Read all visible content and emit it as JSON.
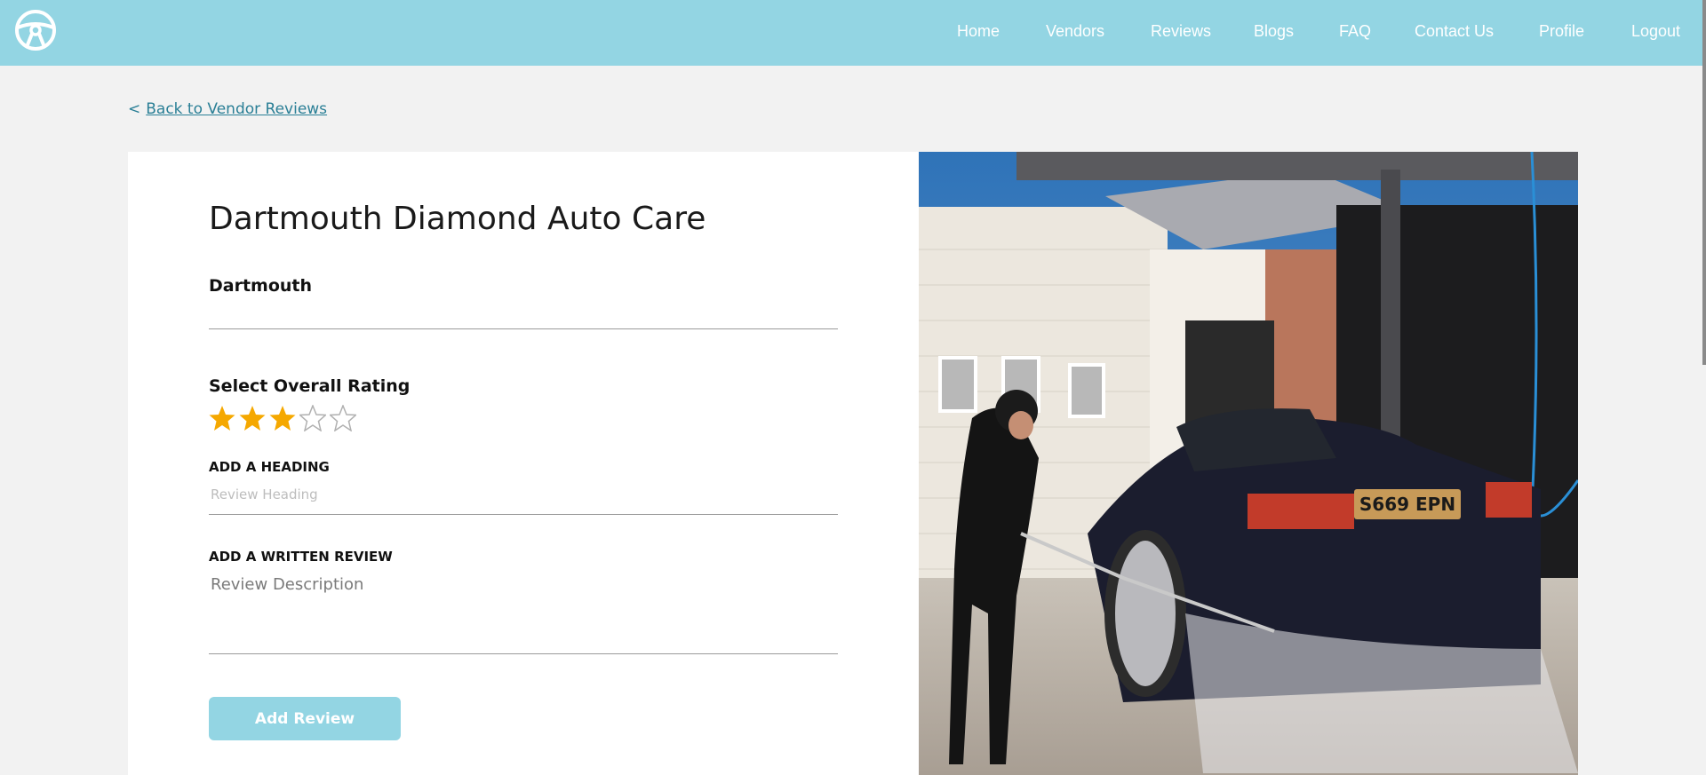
{
  "nav": {
    "logo_icon": "steering-wheel-icon",
    "links": [
      {
        "label": "Home"
      },
      {
        "label": "Vendors"
      },
      {
        "label": "Reviews"
      },
      {
        "label": "Blogs"
      },
      {
        "label": "FAQ"
      },
      {
        "label": "Contact Us"
      },
      {
        "label": "Profile"
      },
      {
        "label": "Logout"
      }
    ]
  },
  "back": {
    "chevron": "<",
    "label": "Back to Vendor Reviews"
  },
  "vendor": {
    "name": "Dartmouth Diamond Auto Care",
    "location": "Dartmouth"
  },
  "rating": {
    "label": "Select Overall Rating",
    "value": 3,
    "max": 5
  },
  "heading_field": {
    "label": "ADD A HEADING",
    "placeholder": "Review Heading",
    "value": ""
  },
  "review_field": {
    "label": "ADD A WRITTEN REVIEW",
    "placeholder": "Review Description",
    "value": ""
  },
  "submit": {
    "label": "Add Review"
  },
  "photo": {
    "plate_text": "S669 EPN"
  },
  "colors": {
    "nav_bg": "#93d5e3",
    "accent_link": "#2a7f96",
    "star_filled": "#f5a800",
    "star_empty": "#b0b0b0",
    "button_bg": "#93d5e3"
  }
}
